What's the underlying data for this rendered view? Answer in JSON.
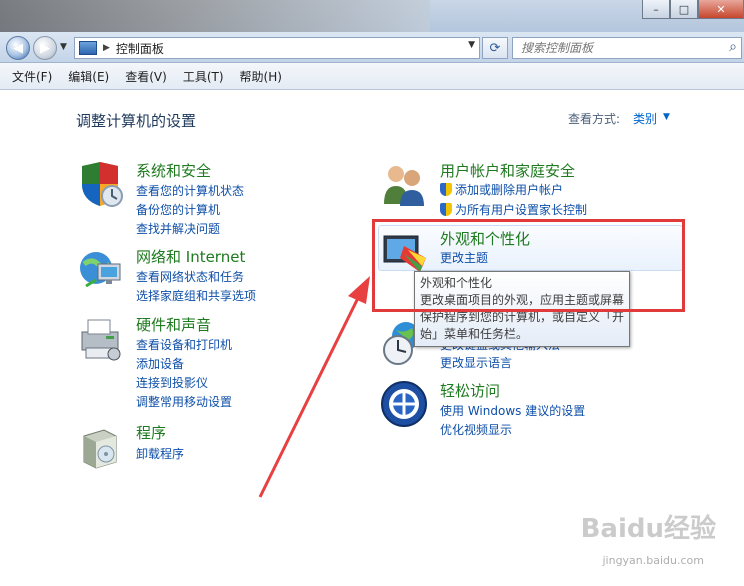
{
  "window": {
    "buttons": [
      "–",
      "□",
      "✕"
    ]
  },
  "address": {
    "breadcrumb": "控制面板",
    "search_placeholder": "搜索控制面板"
  },
  "menu": [
    "文件(F)",
    "编辑(E)",
    "查看(V)",
    "工具(T)",
    "帮助(H)"
  ],
  "page": {
    "title": "调整计算机的设置",
    "view_by_label": "查看方式:",
    "view_by_value": "类别"
  },
  "categories_left": [
    {
      "title": "系统和安全",
      "icon": "security-shield-icon",
      "links": [
        "查看您的计算机状态",
        "备份您的计算机",
        "查找并解决问题"
      ]
    },
    {
      "title": "网络和 Internet",
      "icon": "network-globe-icon",
      "links": [
        "查看网络状态和任务",
        "选择家庭组和共享选项"
      ]
    },
    {
      "title": "硬件和声音",
      "icon": "printer-icon",
      "links": [
        "查看设备和打印机",
        "添加设备",
        "连接到投影仪",
        "调整常用移动设置"
      ]
    },
    {
      "title": "程序",
      "icon": "programs-box-icon",
      "links": [
        "卸载程序"
      ]
    }
  ],
  "categories_right": [
    {
      "title": "用户帐户和家庭安全",
      "icon": "users-icon",
      "links": [
        "添加或删除用户帐户",
        "为所有用户设置家长控制"
      ]
    },
    {
      "title": "外观和个性化",
      "icon": "monitor-palette-icon",
      "links": [
        "更改主题"
      ]
    },
    {
      "title": "",
      "icon": "clock-globe-icon",
      "links": [
        "更改键盘或其他输入法",
        "更改显示语言"
      ]
    },
    {
      "title": "轻松访问",
      "icon": "ease-of-access-icon",
      "links": [
        "使用 Windows 建议的设置",
        "优化视频显示"
      ]
    }
  ],
  "tooltip": {
    "title": "外观和个性化",
    "body": "更改桌面项目的外观，应用主题或屏幕保护程序到您的计算机，或自定义「开始」菜单和任务栏。"
  },
  "watermark": {
    "text": "Baidu经验",
    "sub": "jingyan.baidu.com"
  }
}
